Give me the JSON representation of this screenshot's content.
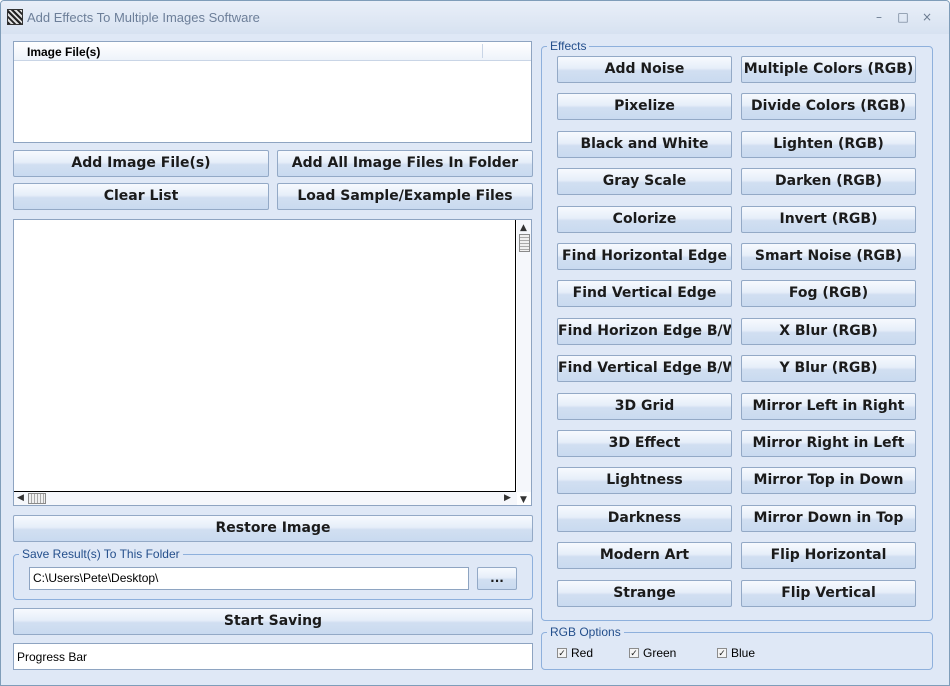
{
  "window": {
    "title": "Add Effects To Multiple Images Software",
    "minimize_glyph": "–",
    "maximize_glyph": "□",
    "close_glyph": "×"
  },
  "file_list": {
    "column_header": "Image File(s)"
  },
  "file_buttons": {
    "add_files": "Add Image File(s)",
    "add_folder": "Add All Image Files In Folder",
    "clear_list": "Clear List",
    "load_samples": "Load Sample/Example Files"
  },
  "restore_button": "Restore Image",
  "save_group": {
    "label": "Save Result(s) To This Folder",
    "path": "C:\\Users\\Pete\\Desktop\\",
    "browse_label": "..."
  },
  "start_button": "Start Saving",
  "progress": {
    "label": "Progress Bar"
  },
  "effects": {
    "label": "Effects",
    "left": [
      "Add Noise",
      "Pixelize",
      "Black and White",
      "Gray Scale",
      "Colorize",
      "Find Horizontal Edge",
      "Find Vertical Edge",
      "Find Horizon Edge B/W",
      "Find Vertical Edge B/W",
      "3D Grid",
      "3D Effect",
      "Lightness",
      "Darkness",
      "Modern Art",
      "Strange"
    ],
    "right": [
      "Multiple Colors (RGB)",
      "Divide Colors (RGB)",
      "Lighten (RGB)",
      "Darken (RGB)",
      "Invert (RGB)",
      "Smart Noise (RGB)",
      "Fog (RGB)",
      "X Blur (RGB)",
      "Y Blur (RGB)",
      "Mirror Left in Right",
      "Mirror Right in Left",
      "Mirror Top in Down",
      "Mirror Down in Top",
      "Flip Horizontal",
      "Flip Vertical"
    ]
  },
  "rgb_options": {
    "label": "RGB Options",
    "red": {
      "label": "Red",
      "checked": true
    },
    "green": {
      "label": "Green",
      "checked": true
    },
    "blue": {
      "label": "Blue",
      "checked": true
    }
  }
}
